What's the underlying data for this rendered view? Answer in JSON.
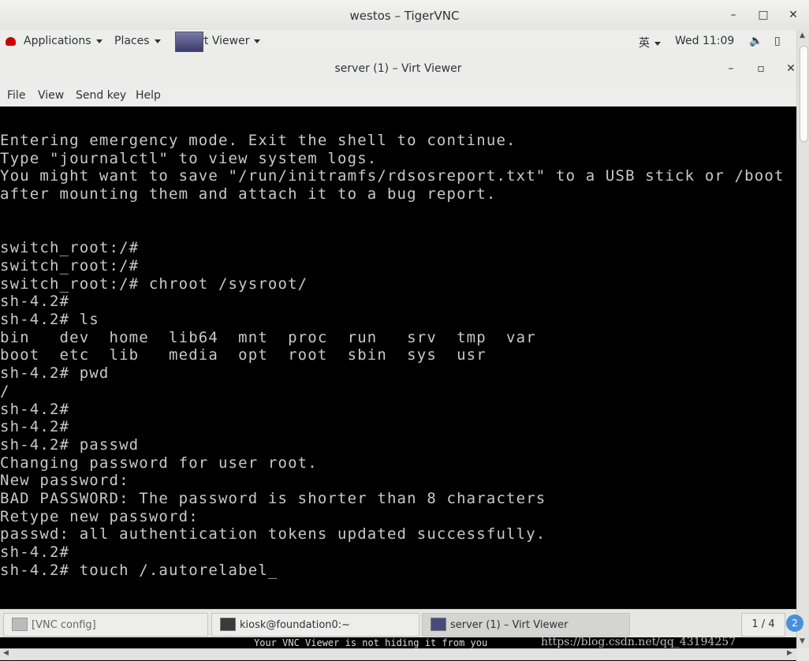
{
  "vnc_window": {
    "title": "westos – TigerVNC",
    "minimize": "–",
    "maximize": "□",
    "close": "✕"
  },
  "topbar": {
    "applications": "Applications",
    "places": "Places",
    "virt_viewer": "Virt Viewer",
    "input_method": "英",
    "clock": "Wed 11:09",
    "volume_icon": "🔈",
    "battery_icon": "▯"
  },
  "virt_viewer": {
    "title": "server (1) – Virt Viewer",
    "minimize": "–",
    "maximize": "▫",
    "close": "✕",
    "menu": {
      "file": "File",
      "view": "View",
      "send_key": "Send key",
      "help": "Help"
    }
  },
  "console": {
    "lines": [
      "Entering emergency mode. Exit the shell to continue.",
      "Type \"journalctl\" to view system logs.",
      "You might want to save \"/run/initramfs/rdsosreport.txt\" to a USB stick or /boot",
      "after mounting them and attach it to a bug report.",
      "",
      "",
      "switch_root:/#",
      "switch_root:/#",
      "switch_root:/# chroot /sysroot/",
      "sh-4.2#",
      "sh-4.2# ls",
      "bin   dev  home  lib64  mnt  proc  run   srv  tmp  var",
      "boot  etc  lib   media  opt  root  sbin  sys  usr",
      "sh-4.2# pwd",
      "/",
      "sh-4.2#",
      "sh-4.2#",
      "sh-4.2# passwd",
      "Changing password for user root.",
      "New password:",
      "BAD PASSWORD: The password is shorter than 8 characters",
      "Retype new password:",
      "passwd: all authentication tokens updated successfully.",
      "sh-4.2#",
      "sh-4.2# touch /.autorelabel_"
    ]
  },
  "taskbar": {
    "tasks": [
      {
        "label": "[VNC config]"
      },
      {
        "label": "kiosk@foundation0:~"
      },
      {
        "label": "server (1) – Virt Viewer"
      }
    ],
    "pager": "1 / 4",
    "pager_badge": "2"
  },
  "bottom": {
    "notice": "Your VNC Viewer is not hiding it from you",
    "watermark": "https://blog.csdn.net/qq_43194257"
  }
}
